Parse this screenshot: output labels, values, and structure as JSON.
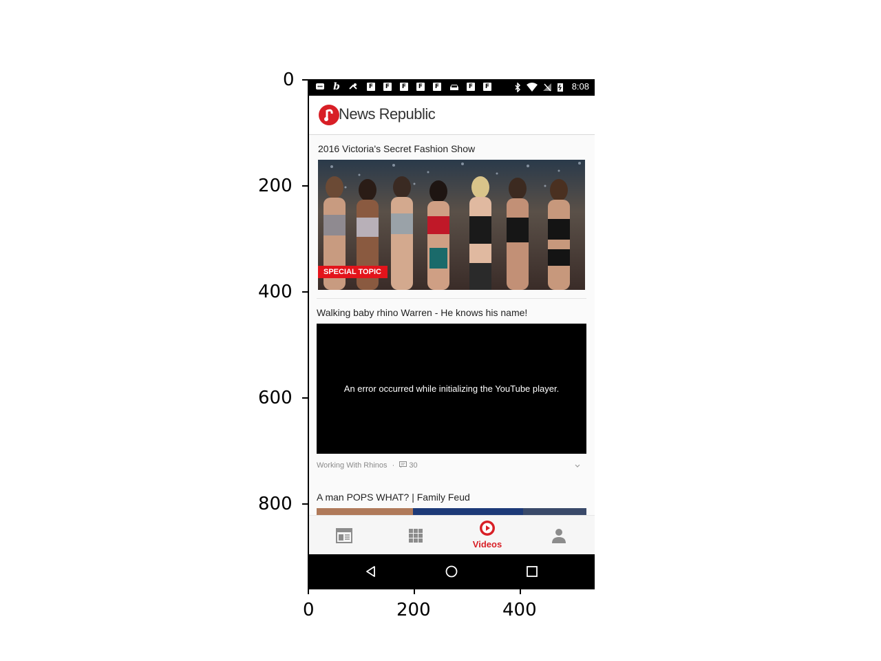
{
  "axis": {
    "y_ticks": [
      "0",
      "200",
      "400",
      "600",
      "800"
    ],
    "x_ticks": [
      "0",
      "200",
      "400"
    ]
  },
  "statusbar": {
    "time": "8:08",
    "left_icons": [
      "message-icon",
      "bing-icon",
      "maps-icon",
      "flipboard-icon",
      "flipboard-icon",
      "flipboard-icon",
      "flipboard-icon",
      "flipboard-icon",
      "car-icon",
      "flipboard-icon",
      "flipboard-icon"
    ],
    "right_icons": [
      "bluetooth-icon",
      "wifi-icon",
      "no-signal-icon",
      "battery-icon"
    ]
  },
  "appbar": {
    "logo_text": "News Republic"
  },
  "feed": {
    "cards": [
      {
        "title": "2016 Victoria's Secret Fashion Show",
        "badge": "SPECIAL TOPIC"
      },
      {
        "title": "Walking baby rhino Warren - He knows his name!",
        "player_message": "An error occurred while initializing the YouTube player.",
        "source": "Working With Rhinos",
        "separator": "·",
        "comment_count": "30"
      },
      {
        "title": "A man POPS WHAT? | Family Feud"
      }
    ]
  },
  "bottomnav": {
    "items": [
      {
        "icon": "news-feed-icon",
        "label": ""
      },
      {
        "icon": "grid-icon",
        "label": ""
      },
      {
        "icon": "play-circle-icon",
        "label": "Videos",
        "active": true
      },
      {
        "icon": "person-icon",
        "label": ""
      }
    ]
  },
  "colors": {
    "accent": "#d81f26",
    "statusbar": "#000000",
    "navbar": "#000000"
  }
}
